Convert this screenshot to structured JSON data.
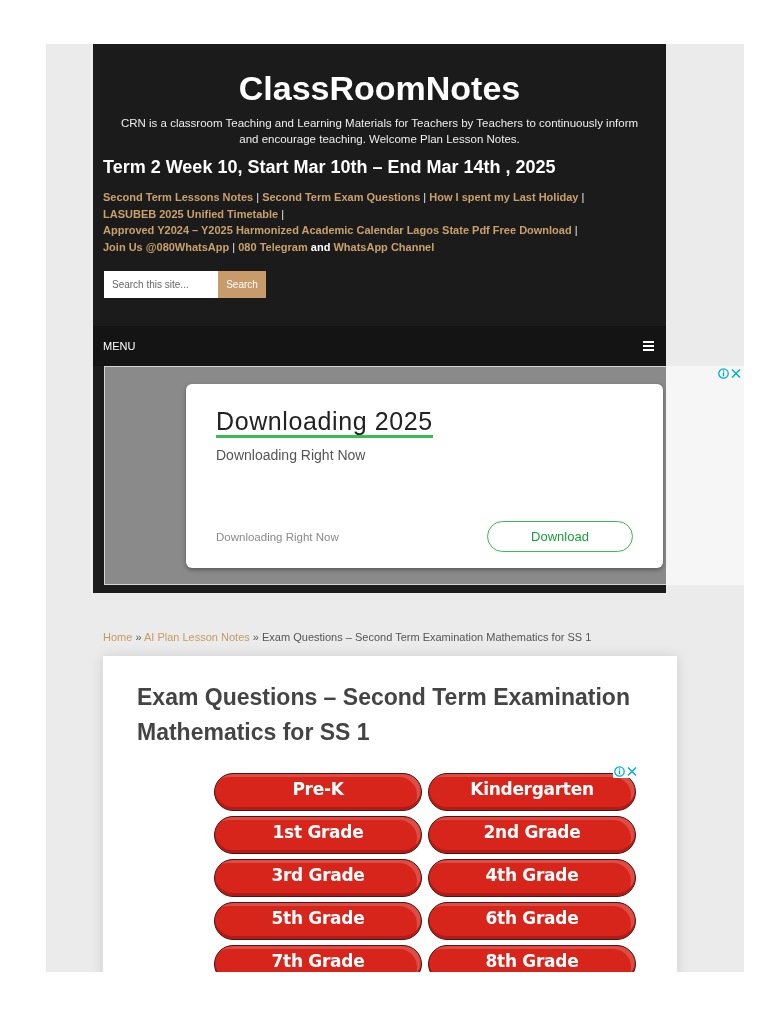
{
  "site": {
    "title": "ClassRoomNotes",
    "description": "CRN is a classroom Teaching and Learning Materials for Teachers by Teachers to continuously inform and encourage teaching. Welcome Plan Lesson Notes."
  },
  "term_banner": "Term 2 Week 10, Start Mar 10th – End Mar 14th , 2025",
  "quick_links": [
    {
      "kind": "link",
      "text": "Second Term Lessons Notes"
    },
    {
      "kind": "separator",
      "text": "|"
    },
    {
      "kind": "link",
      "text": "Second Term Exam Questions"
    },
    {
      "kind": "separator",
      "text": "|"
    },
    {
      "kind": "link",
      "text": "How I spent my Last Holiday"
    },
    {
      "kind": "separator",
      "text": "|"
    },
    {
      "kind": "link",
      "text": "LASUBEB 2025 Unified Timetable"
    },
    {
      "kind": "separator",
      "text": "|"
    },
    {
      "kind": "link",
      "text": "Approved Y2024 – Y2025 Harmonized Academic Calendar Lagos State Pdf Free Download"
    },
    {
      "kind": "separator",
      "text": "|"
    },
    {
      "kind": "link",
      "text": "Join Us @080WhatsApp"
    },
    {
      "kind": "separator",
      "text": "|"
    },
    {
      "kind": "link",
      "text": "080 Telegram"
    },
    {
      "kind": "text",
      "text": "and"
    },
    {
      "kind": "link",
      "text": "WhatsApp Channel"
    }
  ],
  "search": {
    "placeholder": "Search this site...",
    "button": "Search"
  },
  "menu": {
    "label": "MENU"
  },
  "ad_banner": {
    "heading": "Downloading 2025",
    "subheading": "Downloading Right Now",
    "footer_text": "Downloading Right Now",
    "button": "Download"
  },
  "breadcrumb": [
    {
      "kind": "link",
      "text": "Home"
    },
    {
      "kind": "separator",
      "text": "»"
    },
    {
      "kind": "link",
      "text": "AI Plan Lesson Notes"
    },
    {
      "kind": "separator",
      "text": "»"
    },
    {
      "kind": "current",
      "text": "Exam Questions – Second Term Examination Mathematics for SS 1"
    }
  ],
  "article": {
    "title": "Exam Questions – Second Term Examination Mathematics for SS 1"
  },
  "grade_ad": {
    "buttons": [
      "Pre-K",
      "Kindergarten",
      "1st Grade",
      "2nd Grade",
      "3rd Grade",
      "4th Grade",
      "5th Grade",
      "6th Grade",
      "7th Grade",
      "8th Grade"
    ]
  }
}
